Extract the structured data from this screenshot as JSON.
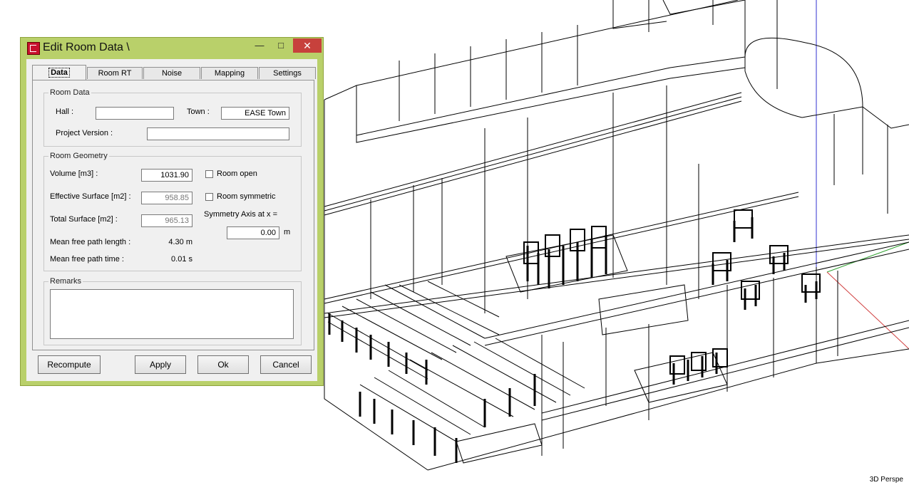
{
  "dialog": {
    "title": "Edit Room Data \\",
    "controls": {
      "minimize": "—",
      "maximize": "□",
      "close": "✕"
    },
    "tabs": [
      "Data",
      "Room RT",
      "Noise",
      "Mapping",
      "Settings"
    ],
    "active_tab": "Data",
    "room_data": {
      "group_title": "Room Data",
      "hall_label": "Hall :",
      "hall_value": "",
      "town_label": "Town :",
      "town_value": "EASE Town",
      "project_version_label": "Project Version :",
      "project_version_value": ""
    },
    "room_geometry": {
      "group_title": "Room Geometry",
      "volume_label": "Volume [m3] :",
      "volume_value": "1031.90",
      "effective_surface_label": "Effective Surface [m2] :",
      "effective_surface_value": "958.85",
      "total_surface_label": "Total Surface [m2] :",
      "total_surface_value": "965.13",
      "mean_free_path_length_label": "Mean free path length :",
      "mean_free_path_length_value": "4.30 m",
      "mean_free_path_time_label": "Mean free path time :",
      "mean_free_path_time_value": "0.01 s",
      "room_open_label": "Room open",
      "room_open_checked": false,
      "room_symmetric_label": "Room symmetric",
      "room_symmetric_checked": false,
      "symmetry_axis_label": "Symmetry Axis at x =",
      "symmetry_axis_value": "0.00",
      "symmetry_axis_unit": "m"
    },
    "remarks": {
      "group_title": "Remarks",
      "value": ""
    },
    "buttons": {
      "recompute": "Recompute",
      "apply": "Apply",
      "ok": "Ok",
      "cancel": "Cancel"
    }
  },
  "viewport": {
    "view_label": "3D Perspe"
  },
  "colors": {
    "window_frame": "#b9d06a",
    "close_button": "#c7413c",
    "dialog_background": "#f0f0f0",
    "wireframe": "#000000",
    "axis_x": "#d04040",
    "axis_y": "#30a030",
    "axis_z": "#3030d0"
  }
}
